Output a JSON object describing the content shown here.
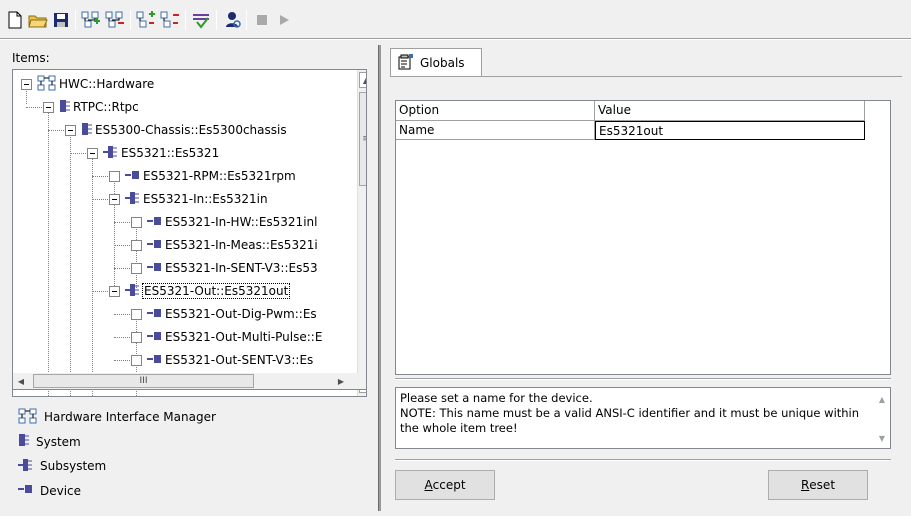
{
  "toolbar": {
    "buttons": [
      {
        "icon": "new-file-icon"
      },
      {
        "icon": "open-folder-icon"
      },
      {
        "icon": "save-icon"
      },
      {
        "icon": "add-system-icon"
      },
      {
        "icon": "remove-system-icon"
      },
      {
        "icon": "add-subsystem-icon"
      },
      {
        "icon": "remove-subsystem-icon"
      },
      {
        "icon": "hardware-connect-icon"
      },
      {
        "icon": "user-search-icon"
      },
      {
        "icon": "stop-icon"
      },
      {
        "icon": "play-icon"
      }
    ]
  },
  "left": {
    "items_label": "Items:",
    "tree": [
      {
        "label": "HWC::Hardware",
        "type": "hardware"
      },
      {
        "label": "RTPC::Rtpc",
        "type": "system"
      },
      {
        "label": "ES5300-Chassis::Es5300chassis",
        "type": "system"
      },
      {
        "label": "ES5321::Es5321",
        "type": "subsystem"
      },
      {
        "label": "ES5321-RPM::Es5321rpm",
        "type": "device"
      },
      {
        "label": "ES5321-In::Es5321in",
        "type": "subsystem"
      },
      {
        "label": "ES5321-In-HW::Es5321inl",
        "type": "device"
      },
      {
        "label": "ES5321-In-Meas::Es5321i",
        "type": "device"
      },
      {
        "label": "ES5321-In-SENT-V3::Es53",
        "type": "device"
      },
      {
        "label": "ES5321-Out::Es5321out",
        "type": "subsystem",
        "selected": true
      },
      {
        "label": "ES5321-Out-Dig-Pwm::Es",
        "type": "device"
      },
      {
        "label": "ES5321-Out-Multi-Pulse::E",
        "type": "device"
      },
      {
        "label": "ES5321-Out-SENT-V3::Es",
        "type": "device"
      }
    ],
    "hscroll_thumb": "III",
    "vscroll_thumb": "≡",
    "legend": [
      {
        "label": "Hardware Interface Manager",
        "type": "hardware"
      },
      {
        "label": "System",
        "type": "system"
      },
      {
        "label": "Subsystem",
        "type": "subsystem"
      },
      {
        "label": "Device",
        "type": "device"
      }
    ]
  },
  "right": {
    "tab_label": "Globals",
    "grid": {
      "columns": [
        "Option",
        "Value"
      ],
      "rows": [
        {
          "option": "Name",
          "value": "Es5321out"
        }
      ]
    },
    "info_text": "Please set a name for the device.\nNOTE: This name must be a valid ANSI-C identifier and it must be unique within the whole item tree!",
    "accept_button": {
      "underline": "A",
      "rest": "ccept"
    },
    "reset_button": {
      "underline": "R",
      "rest": "eset"
    }
  },
  "colors": {
    "system_icon": "#4b4b9b",
    "hardware_icon": "#3c6ea8",
    "background": "#f0f0f0"
  }
}
